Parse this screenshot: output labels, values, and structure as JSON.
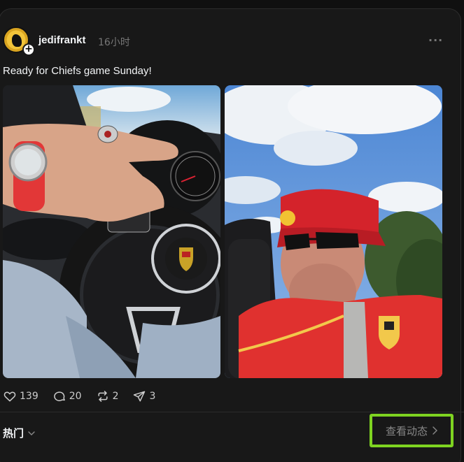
{
  "post": {
    "author": "jedifrankt",
    "timestamp": "16小时",
    "more_icon": "more-horizontal-icon",
    "caption": "Ready for Chiefs game Sunday!",
    "images": [
      {
        "alt": "Hand on Porsche steering wheel in car interior"
      },
      {
        "alt": "Selfie of man in red Ferrari cap and shirt in convertible under blue sky"
      }
    ],
    "stats": {
      "likes": "139",
      "comments": "20",
      "reposts": "2",
      "shares": "3"
    }
  },
  "footer": {
    "sort_label": "热门",
    "view_activity_label": "查看动态"
  },
  "colors": {
    "background": "#181818",
    "highlight": "#7ed321"
  }
}
